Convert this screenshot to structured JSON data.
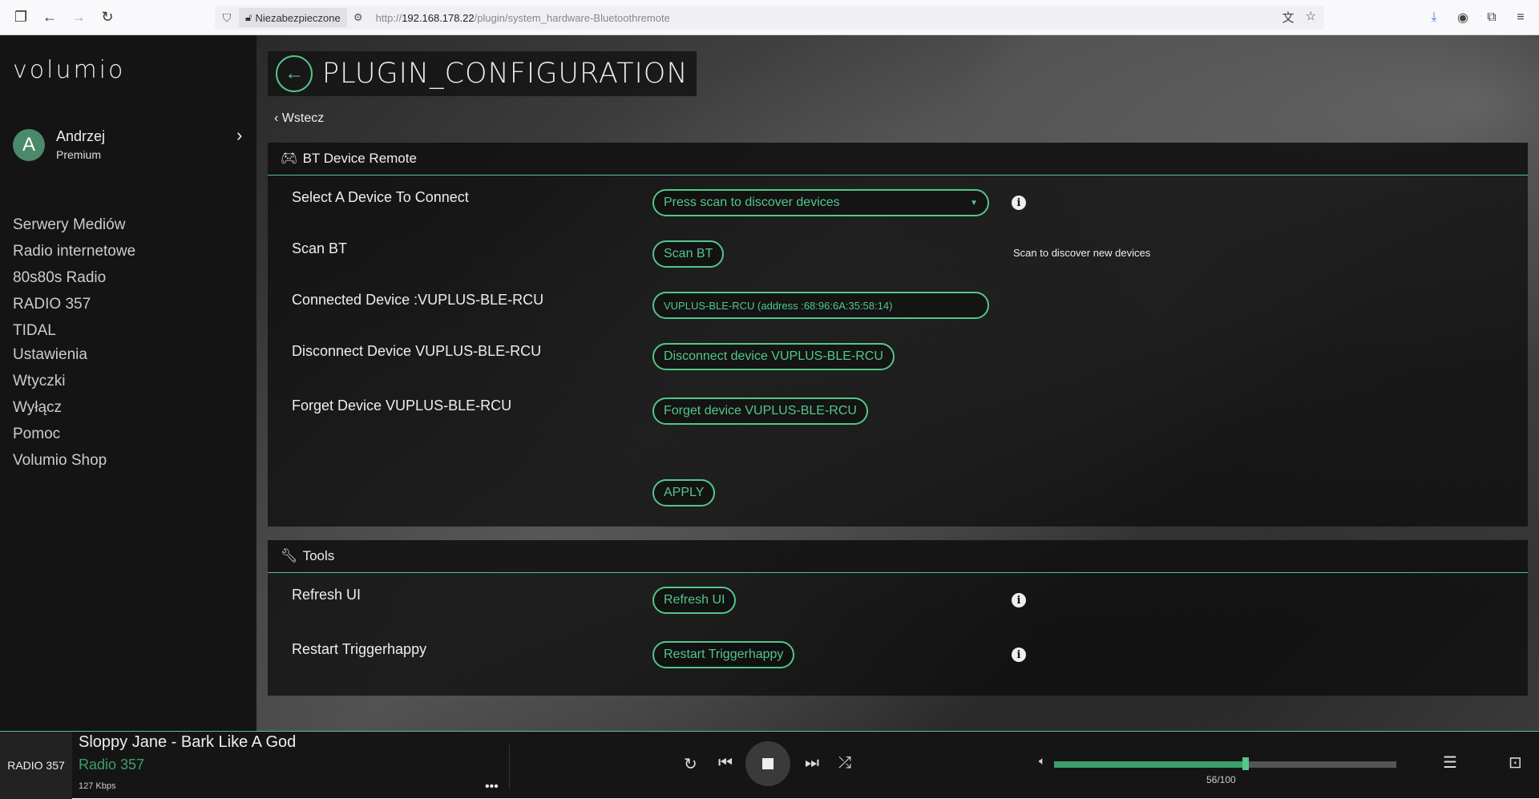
{
  "browser": {
    "insecure_label": "Niezabezpieczone",
    "url_prefix": "http://",
    "url_host": "192.168.178.22",
    "url_path": "/plugin/system_hardware-Bluetoothremote"
  },
  "sidebar": {
    "logo": "volumio",
    "user": {
      "initial": "A",
      "name": "Andrzej",
      "tier": "Premium"
    },
    "sources": [
      "Serwery Mediów",
      "Radio internetowe",
      "80s80s Radio",
      "RADIO 357",
      "TIDAL"
    ],
    "system": [
      "Ustawienia",
      "Wtyczki",
      "Wyłącz",
      "Pomoc",
      "Volumio Shop"
    ]
  },
  "page": {
    "title": "PLUGIN_CONFIGURATION",
    "back_label": "Wstecz"
  },
  "section_bt": {
    "title": "BT Device Remote",
    "select_label": "Select A Device To Connect",
    "select_value": "Press scan to discover devices",
    "scan_label": "Scan BT",
    "scan_button": "Scan BT",
    "scan_hint": "Scan to discover new devices",
    "connected_label": "Connected Device :VUPLUS-BLE-RCU",
    "connected_value": "VUPLUS-BLE-RCU (address :68:96:6A:35:58:14)",
    "disconnect_label": "Disconnect Device VUPLUS-BLE-RCU",
    "disconnect_button": "Disconnect device VUPLUS-BLE-RCU",
    "forget_label": "Forget Device VUPLUS-BLE-RCU",
    "forget_button": "Forget device VUPLUS-BLE-RCU",
    "apply_button": "APPLY"
  },
  "section_tools": {
    "title": "Tools",
    "refresh_label": "Refresh UI",
    "refresh_button": "Refresh UI",
    "restart_label": "Restart Triggerhappy",
    "restart_button": "Restart Triggerhappy"
  },
  "player": {
    "station_logo": "RADIO 357",
    "song": "Sloppy Jane - Bark Like A God",
    "artist": "Radio 357",
    "bitrate": "127 Kbps",
    "volume": 56,
    "volume_text": "56/100"
  },
  "colors": {
    "accent": "#54c68a",
    "sidebar_bg": "#141414"
  }
}
